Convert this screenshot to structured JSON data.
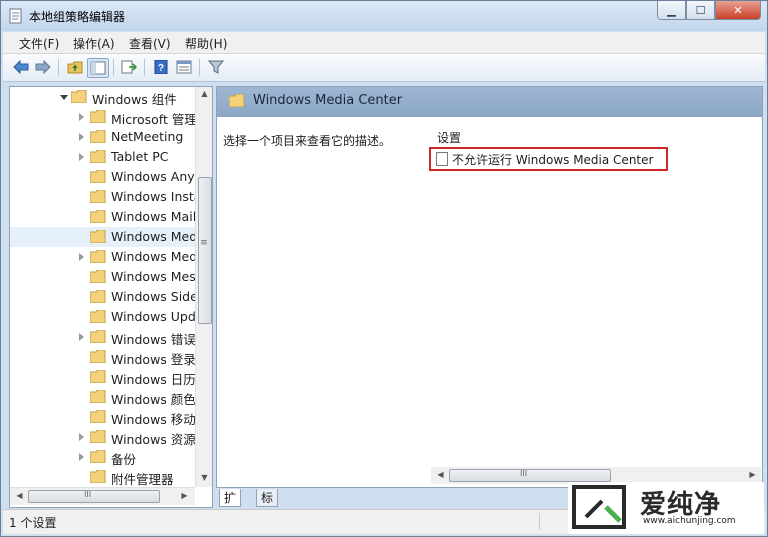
{
  "window": {
    "title": "本地组策略编辑器",
    "btn_min": "▁",
    "btn_max": "☐",
    "btn_close": "✕"
  },
  "menu": [
    "文件(F)",
    "操作(A)",
    "查看(V)",
    "帮助(H)"
  ],
  "toolbar": {
    "icons": [
      "back-arrow-icon",
      "forward-arrow-icon",
      "up-folder-icon",
      "show-tree-icon",
      "export-icon",
      "help-icon",
      "properties-icon",
      "filter-icon"
    ]
  },
  "tree": {
    "root_label": "Windows 组件",
    "items": [
      {
        "label": "Microsoft 管理",
        "expand": true
      },
      {
        "label": "NetMeeting",
        "expand": true
      },
      {
        "label": "Tablet PC",
        "expand": true
      },
      {
        "label": "Windows Anyt",
        "expand": false
      },
      {
        "label": "Windows Insta",
        "expand": false
      },
      {
        "label": "Windows Mail",
        "expand": false
      },
      {
        "label": "Windows Med",
        "expand": false,
        "selected": true
      },
      {
        "label": "Windows Med",
        "expand": true
      },
      {
        "label": "Windows Mes",
        "expand": false
      },
      {
        "label": "Windows Side",
        "expand": false
      },
      {
        "label": "Windows Upd",
        "expand": false
      },
      {
        "label": "Windows 错误",
        "expand": true
      },
      {
        "label": "Windows 登录",
        "expand": false
      },
      {
        "label": "Windows 日历",
        "expand": false
      },
      {
        "label": "Windows 颜色",
        "expand": false
      },
      {
        "label": "Windows 移动",
        "expand": false
      },
      {
        "label": "Windows 资源",
        "expand": true
      },
      {
        "label": "备份",
        "expand": true
      },
      {
        "label": "附件管理器",
        "expand": false
      }
    ]
  },
  "right_pane": {
    "header": "Windows Media Center",
    "description": "选择一个项目来查看它的描述。",
    "column_header": "设置",
    "setting": "不允许运行 Windows Media Center"
  },
  "tabs": [
    "扩展",
    "标准"
  ],
  "status": {
    "text": "1 个设置"
  },
  "scroll": {
    "thumb_glyph": "III",
    "vthumb_glyph": "≡",
    "arrow_up": "▲",
    "arrow_down": "▼",
    "arrow_left": "◀",
    "arrow_right": "▶"
  },
  "watermark": {
    "brand": "爱纯净",
    "url": "www.aichunjing.com"
  }
}
